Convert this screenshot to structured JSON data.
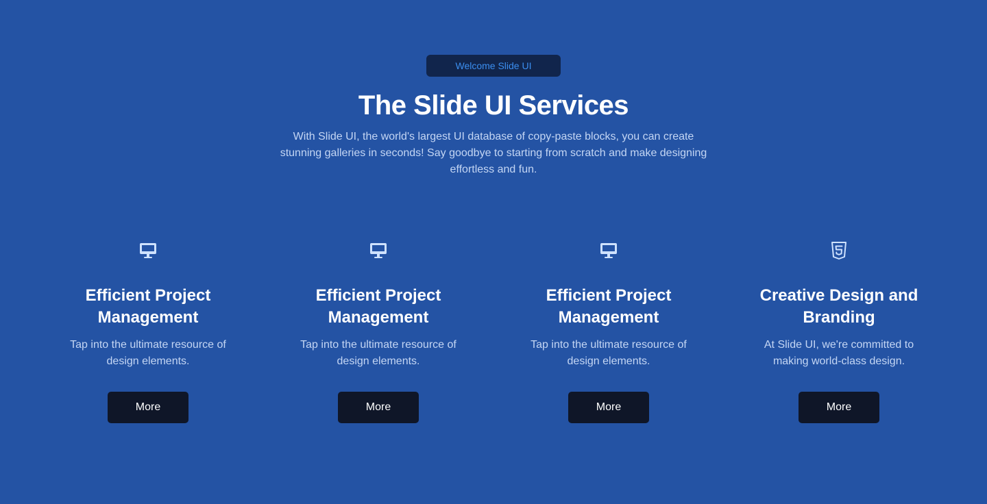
{
  "hero": {
    "badge": "Welcome Slide UI",
    "title": "The Slide UI Services",
    "subtitle": "With Slide UI, the world's largest UI database of copy-paste blocks, you can create stunning galleries in seconds! Say goodbye to starting from scratch and make designing effortless and fun."
  },
  "colors": {
    "background": "#2453a4",
    "badge_bg": "#11254c",
    "badge_text": "#3b8ef0",
    "button_bg": "#0f1628",
    "icon": "#cfe2ff"
  },
  "services": [
    {
      "icon": "monitor-icon",
      "title": "Efficient Project Management",
      "description": "Tap into the ultimate resource of design elements.",
      "button_label": "More"
    },
    {
      "icon": "monitor-icon",
      "title": "Efficient Project Management",
      "description": "Tap into the ultimate resource of design elements.",
      "button_label": "More"
    },
    {
      "icon": "monitor-icon",
      "title": "Efficient Project Management",
      "description": "Tap into the ultimate resource of design elements.",
      "button_label": "More"
    },
    {
      "icon": "html5-icon",
      "title": "Creative Design and Branding",
      "description": "At Slide UI, we're committed to making world-class design.",
      "button_label": "More"
    }
  ]
}
